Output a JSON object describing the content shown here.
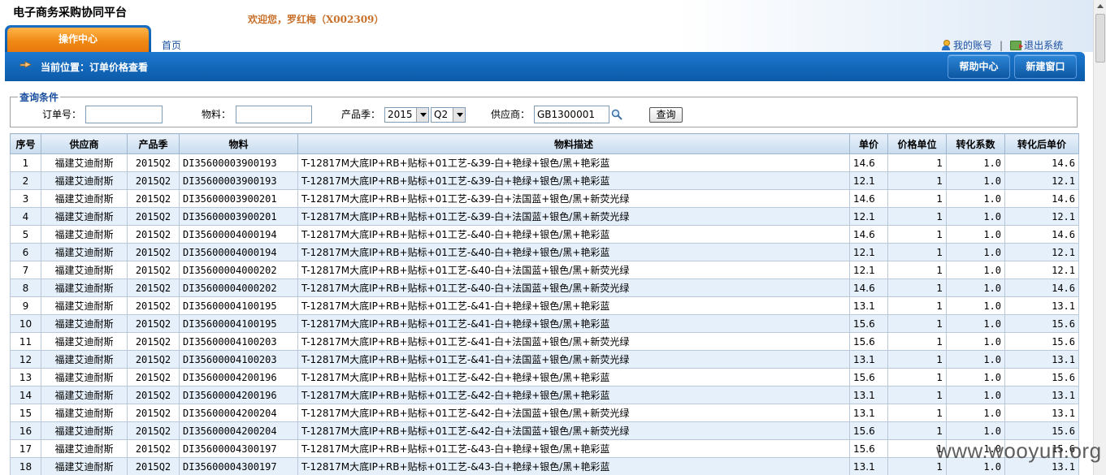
{
  "header": {
    "app_title": "电子商务采购协同平台",
    "welcome": "欢迎您，罗红梅（X002309）",
    "op_tab": "操作中心",
    "home_link": "首页",
    "my_account": "我的账号",
    "separator": "|",
    "logout": "退出系统"
  },
  "location": {
    "text": "当前位置：订单价格查看",
    "help_button": "帮助中心",
    "new_window_button": "新建窗口"
  },
  "query": {
    "legend": "查询条件",
    "order_label": "订单号：",
    "order_value": "",
    "material_label": "物料：",
    "material_value": "",
    "season_label": "产品季：",
    "season_year": "2015",
    "season_quarter": "Q2",
    "supplier_label": "供应商：",
    "supplier_value": "GB1300001",
    "search_button": "查询"
  },
  "table": {
    "headers": [
      "序号",
      "供应商",
      "产品季",
      "物料",
      "物料描述",
      "单价",
      "价格单位",
      "转化系数",
      "转化后单价"
    ],
    "rows": [
      [
        "1",
        "福建艾迪耐斯",
        "2015Q2",
        "DI35600003900193",
        "T-12817M大底IP+RB+贴标+01工艺-&39-白+艳绿+银色/黑+艳彩蓝",
        "14.6",
        "1",
        "1.0",
        "14.6"
      ],
      [
        "2",
        "福建艾迪耐斯",
        "2015Q2",
        "DI35600003900193",
        "T-12817M大底IP+RB+贴标+01工艺-&39-白+艳绿+银色/黑+艳彩蓝",
        "12.1",
        "1",
        "1.0",
        "12.1"
      ],
      [
        "3",
        "福建艾迪耐斯",
        "2015Q2",
        "DI35600003900201",
        "T-12817M大底IP+RB+贴标+01工艺-&39-白+法国蓝+银色/黑+新荧光绿",
        "14.6",
        "1",
        "1.0",
        "14.6"
      ],
      [
        "4",
        "福建艾迪耐斯",
        "2015Q2",
        "DI35600003900201",
        "T-12817M大底IP+RB+贴标+01工艺-&39-白+法国蓝+银色/黑+新荧光绿",
        "12.1",
        "1",
        "1.0",
        "12.1"
      ],
      [
        "5",
        "福建艾迪耐斯",
        "2015Q2",
        "DI35600004000194",
        "T-12817M大底IP+RB+贴标+01工艺-&40-白+艳绿+银色/黑+艳彩蓝",
        "14.6",
        "1",
        "1.0",
        "14.6"
      ],
      [
        "6",
        "福建艾迪耐斯",
        "2015Q2",
        "DI35600004000194",
        "T-12817M大底IP+RB+贴标+01工艺-&40-白+艳绿+银色/黑+艳彩蓝",
        "12.1",
        "1",
        "1.0",
        "12.1"
      ],
      [
        "7",
        "福建艾迪耐斯",
        "2015Q2",
        "DI35600004000202",
        "T-12817M大底IP+RB+贴标+01工艺-&40-白+法国蓝+银色/黑+新荧光绿",
        "12.1",
        "1",
        "1.0",
        "12.1"
      ],
      [
        "8",
        "福建艾迪耐斯",
        "2015Q2",
        "DI35600004000202",
        "T-12817M大底IP+RB+贴标+01工艺-&40-白+法国蓝+银色/黑+新荧光绿",
        "14.6",
        "1",
        "1.0",
        "14.6"
      ],
      [
        "9",
        "福建艾迪耐斯",
        "2015Q2",
        "DI35600004100195",
        "T-12817M大底IP+RB+贴标+01工艺-&41-白+艳绿+银色/黑+艳彩蓝",
        "13.1",
        "1",
        "1.0",
        "13.1"
      ],
      [
        "10",
        "福建艾迪耐斯",
        "2015Q2",
        "DI35600004100195",
        "T-12817M大底IP+RB+贴标+01工艺-&41-白+艳绿+银色/黑+艳彩蓝",
        "15.6",
        "1",
        "1.0",
        "15.6"
      ],
      [
        "11",
        "福建艾迪耐斯",
        "2015Q2",
        "DI35600004100203",
        "T-12817M大底IP+RB+贴标+01工艺-&41-白+法国蓝+银色/黑+新荧光绿",
        "15.6",
        "1",
        "1.0",
        "15.6"
      ],
      [
        "12",
        "福建艾迪耐斯",
        "2015Q2",
        "DI35600004100203",
        "T-12817M大底IP+RB+贴标+01工艺-&41-白+法国蓝+银色/黑+新荧光绿",
        "13.1",
        "1",
        "1.0",
        "13.1"
      ],
      [
        "13",
        "福建艾迪耐斯",
        "2015Q2",
        "DI35600004200196",
        "T-12817M大底IP+RB+贴标+01工艺-&42-白+艳绿+银色/黑+艳彩蓝",
        "15.6",
        "1",
        "1.0",
        "15.6"
      ],
      [
        "14",
        "福建艾迪耐斯",
        "2015Q2",
        "DI35600004200196",
        "T-12817M大底IP+RB+贴标+01工艺-&42-白+艳绿+银色/黑+艳彩蓝",
        "13.1",
        "1",
        "1.0",
        "13.1"
      ],
      [
        "15",
        "福建艾迪耐斯",
        "2015Q2",
        "DI35600004200204",
        "T-12817M大底IP+RB+贴标+01工艺-&42-白+法国蓝+银色/黑+新荧光绿",
        "13.1",
        "1",
        "1.0",
        "13.1"
      ],
      [
        "16",
        "福建艾迪耐斯",
        "2015Q2",
        "DI35600004200204",
        "T-12817M大底IP+RB+贴标+01工艺-&42-白+法国蓝+银色/黑+新荧光绿",
        "15.6",
        "1",
        "1.0",
        "15.6"
      ],
      [
        "17",
        "福建艾迪耐斯",
        "2015Q2",
        "DI35600004300197",
        "T-12817M大底IP+RB+贴标+01工艺-&43-白+艳绿+银色/黑+艳彩蓝",
        "15.6",
        "1",
        "1.0",
        "15.6"
      ],
      [
        "18",
        "福建艾迪耐斯",
        "2015Q2",
        "DI35600004300197",
        "T-12817M大底IP+RB+贴标+01工艺-&43-白+艳绿+银色/黑+艳彩蓝",
        "13.1",
        "1",
        "1.0",
        "13.1"
      ]
    ]
  },
  "watermark": "www.wooyun.org",
  "colors": {
    "accent_blue": "#0b5aa8",
    "tab_orange": "#f08a14",
    "welcome_text": "#c8702a",
    "row_alt": "#e6f0fa"
  }
}
